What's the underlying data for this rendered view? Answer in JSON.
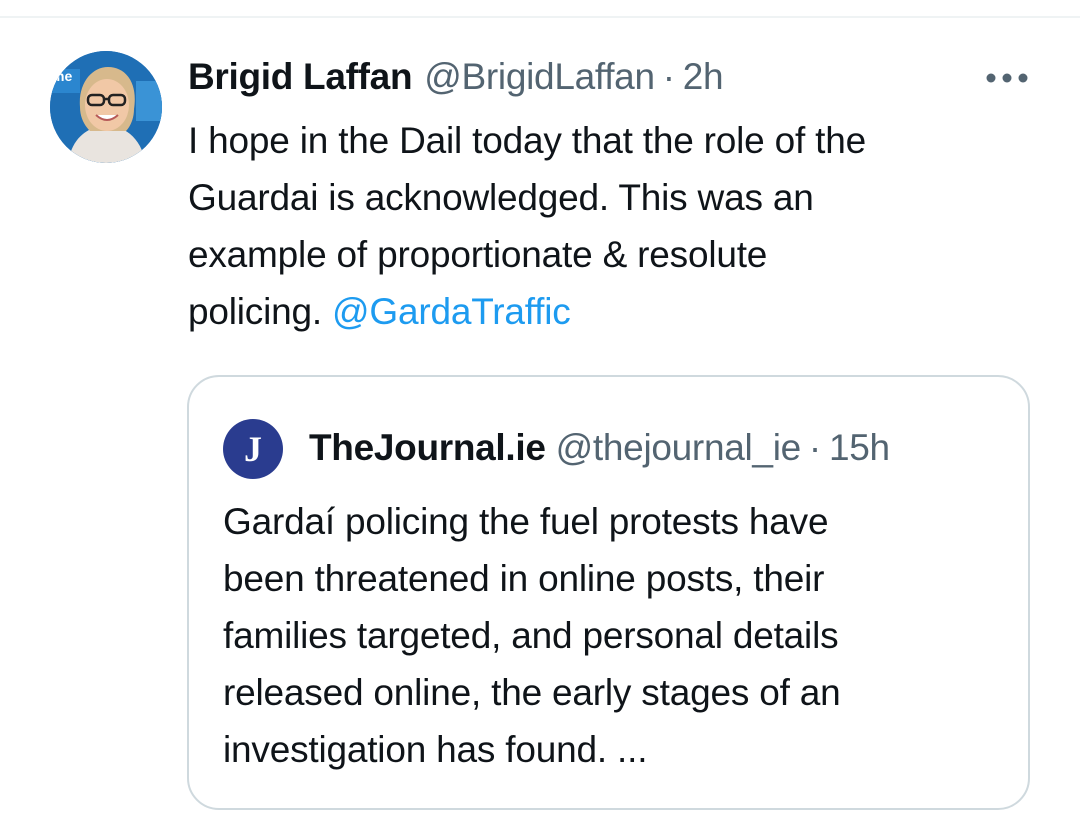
{
  "tweet": {
    "author_name": "Brigid Laffan",
    "author_handle": "@BrigidLaffan",
    "separator": "·",
    "time": "2h",
    "more_icon": "more-horizontal-icon",
    "avatar_icon": "profile-photo",
    "text_lines": [
      "I hope in the Dail today that the role of the",
      "Guardai is acknowledged. This was an",
      "example of proportionate & resolute",
      "policing."
    ],
    "mention": "@GardaTraffic",
    "link_color": "#1d9bf0"
  },
  "quoted_tweet": {
    "author_name": "TheJournal.ie",
    "author_handle": "@thejournal_ie",
    "separator": "·",
    "time": "15h",
    "avatar_letter": "J",
    "text_lines": [
      "Gardaí policing the fuel protests have",
      "been threatened in online posts, their",
      "families targeted, and personal details",
      "released online, the early stages of an",
      "investigation has found. ..."
    ]
  }
}
